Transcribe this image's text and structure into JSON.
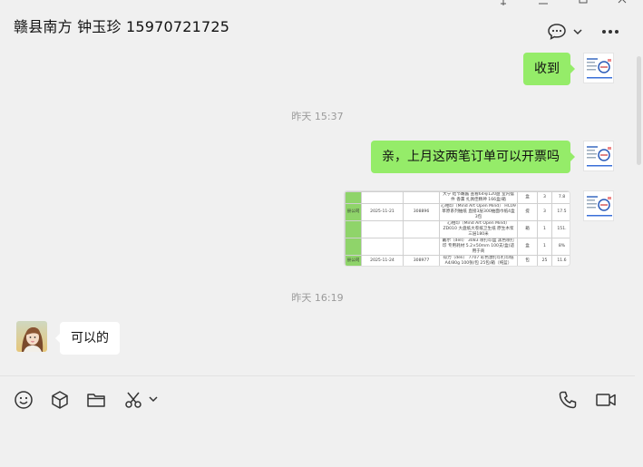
{
  "header": {
    "title": "赣县南方 钟玉珍 15970721725"
  },
  "messages": {
    "m1_text": "收到",
    "ts1": "昨天 15:37",
    "m2_text": "亲，上月这两笔订单可以开票吗",
    "ts2": "昨天 16:19",
    "m3_text": "可以的"
  },
  "image_table": {
    "rows": [
      [
        "",
        "",
        "",
        "大宁 结节蘸酱 查看64号120盘 室内摆件 香薰 扎佩佳精神 166盒/箱",
        "盒",
        "3",
        "7.8"
      ],
      [
        "",
        "2025-11-21",
        "308896",
        "心相印（Mind Art Open Mind） HC09 草原系列抽纸 直接3层300抽面巾纸4盒 3包",
        "提",
        "3",
        "17.5"
      ],
      [
        "",
        "",
        "",
        "心相印（Mind Art Open Mind） ZD010 大盘纸大卷纸卫生纸 原生木浆 三层180米",
        "箱",
        "1",
        "151."
      ],
      [
        "",
        "",
        "",
        "戴尔（dell） 3083 喷打印盒 黑色喷打印 专用耗材 5.2×50mm 100支/盒(适用于商",
        "盒",
        "1",
        "8%"
      ],
      [
        "",
        "2025-11-24",
        "308977",
        "得力（deli） 7707 彩色激打印打印纸 A4/80g 100张/包 25包/箱（纯蓝）",
        "包",
        "25",
        "11.6"
      ],
      [
        "",
        "",
        "",
        "",
        "",
        "",
        ""
      ]
    ],
    "company_fragment": "县公司"
  },
  "colors": {
    "self_bubble": "#95ec69",
    "other_bubble": "#ffffff",
    "background": "#f0f0f0"
  },
  "toolbar": {
    "icons": [
      "emoji-icon",
      "cube-icon",
      "folder-icon",
      "scissors-icon",
      "chevron-down-icon",
      "phone-icon",
      "video-camera-icon"
    ]
  }
}
